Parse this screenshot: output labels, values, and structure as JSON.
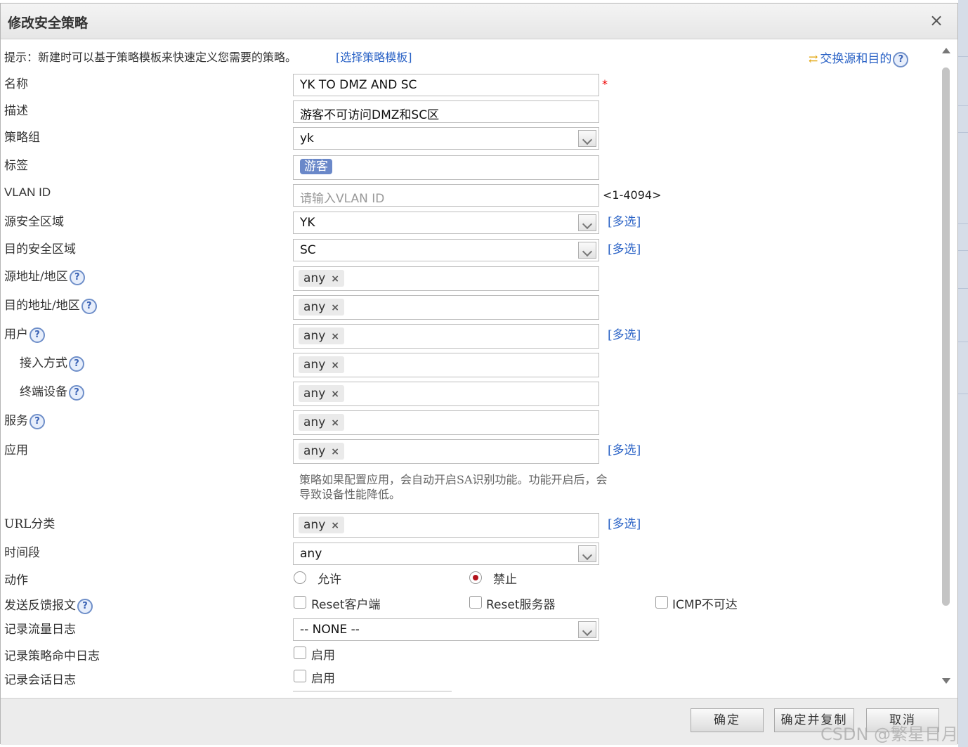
{
  "dialog": {
    "title": "修改安全策略",
    "close_label": "×"
  },
  "hint": {
    "text": "提示：新建时可以基于策略模板来快速定义您需要的策略。",
    "template_link": "[选择策略模板]",
    "swap_link": "交换源和目的"
  },
  "fields": {
    "name": {
      "label": "名称",
      "value": "YK TO DMZ AND SC",
      "required_mark": "*"
    },
    "desc": {
      "label": "描述",
      "value": "游客不可访问DMZ和SC区"
    },
    "group": {
      "label": "策略组",
      "value": "yk"
    },
    "tag": {
      "label": "标签",
      "value": "游客"
    },
    "vlan": {
      "label": "VLAN ID",
      "placeholder": "请输入VLAN ID",
      "range": "<1-4094>"
    },
    "src_zone": {
      "label": "源安全区域",
      "value": "YK",
      "multi": "[多选]"
    },
    "dst_zone": {
      "label": "目的安全区域",
      "value": "SC",
      "multi": "[多选]"
    },
    "src_addr": {
      "label": "源地址/地区",
      "chip": "any"
    },
    "dst_addr": {
      "label": "目的地址/地区",
      "chip": "any"
    },
    "user": {
      "label": "用户",
      "chip": "any",
      "multi": "[多选]"
    },
    "access": {
      "label": "接入方式",
      "chip": "any"
    },
    "terminal": {
      "label": "终端设备",
      "chip": "any"
    },
    "service": {
      "label": "服务",
      "chip": "any"
    },
    "app": {
      "label": "应用",
      "chip": "any",
      "multi": "[多选]",
      "note": "策略如果配置应用，会自动开启SA识别功能。功能开启后，会导致设备性能降低。"
    },
    "url": {
      "label": "URL分类",
      "chip": "any",
      "multi": "[多选]"
    },
    "time": {
      "label": "时间段",
      "value": "any"
    },
    "action": {
      "label": "动作",
      "allow": "允许",
      "deny": "禁止",
      "selected": "禁止"
    },
    "feedback": {
      "label": "发送反馈报文",
      "opt1": "Reset客户端",
      "opt2": "Reset服务器",
      "opt3": "ICMP不可达"
    },
    "traffic_log": {
      "label": "记录流量日志",
      "value": "-- NONE --"
    },
    "hit_log": {
      "label": "记录策略命中日志",
      "opt": "启用"
    },
    "session_log": {
      "label": "记录会话日志",
      "opt": "启用"
    }
  },
  "help_glyph": "?",
  "chip_remove": "×",
  "footer": {
    "ok": "确定",
    "ok_copy": "确定并复制",
    "cancel": "取消"
  },
  "watermark": "CSDN @繁星日月",
  "colors": {
    "link": "#2b63c6",
    "tag": "#6a88c9",
    "radio_selected": "#b3131c",
    "required": "#e00000"
  }
}
